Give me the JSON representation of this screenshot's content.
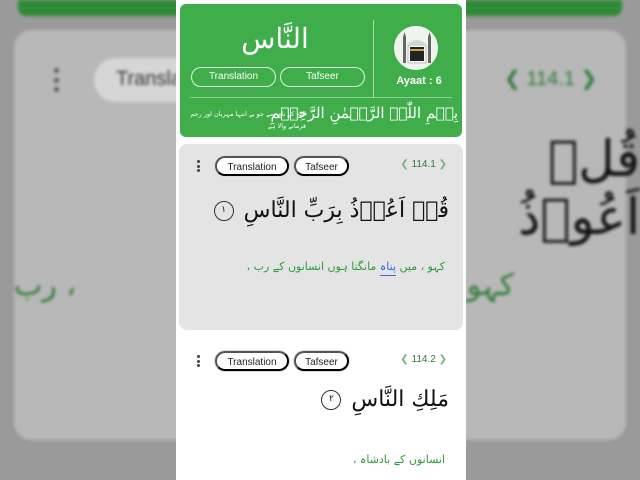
{
  "header": {
    "surah_name_arabic": "النَّاس",
    "translation_label": "Translation",
    "tafseer_label": "Tafseer",
    "ayaat_label": "Ayaat : 6",
    "bismillah_arabic": "بِسۡمِ اللّٰہِ الرَّحۡمٰنِ الرَّحِیۡمِ",
    "bismillah_urdu": "اللہ کے نام سے جو بے انتہا مہربان اور رحم فرمانے والا ہے"
  },
  "verses": [
    {
      "number": "114.1",
      "translation_label": "Translation",
      "tafseer_label": "Tafseer",
      "arabic": "قُلۡ اَعُوۡذُ بِرَبِّ النَّاسِ",
      "ayah_mark": "١",
      "urdu_before": "کہو ، میں",
      "urdu_highlight": "پناہ",
      "urdu_after": "مانگتا ہوں انسانوں کے رب ،"
    },
    {
      "number": "114.2",
      "translation_label": "Translation",
      "tafseer_label": "Tafseer",
      "arabic": "مَلِكِ النَّاسِ",
      "ayah_mark": "٢",
      "urdu": "انسانوں کے بادشاہ ،"
    }
  ],
  "background": {
    "pill_text": "Translation",
    "verse_number": "114.1",
    "arabic": "قُلۡ اَعُوۡذُ",
    "urdu_left": "کہو ، میں",
    "urdu_right": "، رب"
  },
  "colors": {
    "header_green": "#3fae4a",
    "verse_number_green": "#2f7a36",
    "urdu_green": "#2f9a3a",
    "highlight_blue": "#2d6fd6"
  }
}
